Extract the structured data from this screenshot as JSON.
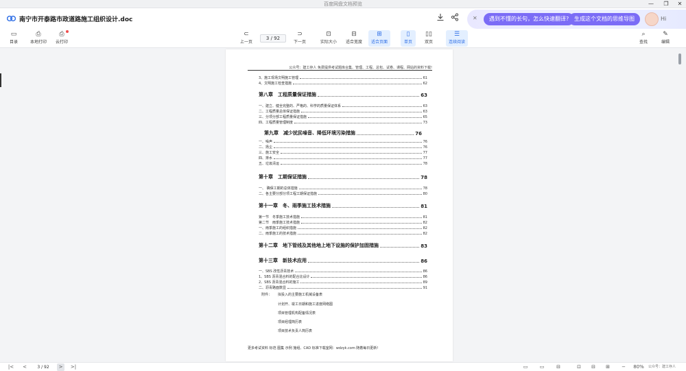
{
  "window": {
    "app_title": "百度网盘文档预览",
    "minimize": "—",
    "maximize": "❐",
    "close": "✕"
  },
  "header": {
    "doc_title": "南宁市开泰路市政道路施工组织设计.doc",
    "download_icon": "download-icon",
    "share_icon": "share-icon"
  },
  "ai_bar": {
    "close": "✕",
    "pill_translate": "遇到不懂的长句，怎么快速翻译?",
    "pill_mindmap": "生成这个文档的思维导图",
    "greeting": "Hi"
  },
  "toolbar": {
    "left": [
      {
        "label": "目录",
        "icon": "toc-icon",
        "glyph": "▭"
      },
      {
        "label": "本地打印",
        "icon": "print-icon",
        "glyph": "⎙"
      },
      {
        "label": "云打印",
        "icon": "cloud-print-icon",
        "glyph": "⎙"
      }
    ],
    "prev_label": "上一页",
    "next_label": "下一页",
    "page_value": "3 / 92",
    "views": [
      {
        "label": "实际大小",
        "glyph": "⊡"
      },
      {
        "label": "适合宽度",
        "glyph": "⊟"
      },
      {
        "label": "适合页面",
        "glyph": "⊞"
      },
      {
        "label": "单页",
        "glyph": "▯"
      },
      {
        "label": "双页",
        "glyph": "▯▯"
      },
      {
        "label": "连续阅读",
        "glyph": "☰"
      }
    ],
    "find_label": "查找",
    "edit_label": "编辑"
  },
  "document": {
    "running_header": "公众号：建工存人 免费提供考试题库合集、管理、工程、总包、试卷、课程、网站的资料下载!",
    "toc": [
      {
        "type": "it",
        "text": "3、施工现场文明施工管理",
        "page": "61"
      },
      {
        "type": "it",
        "text": "4、文明施工检查措施",
        "page": "62"
      },
      {
        "type": "ch",
        "text": "第八章　工程质量保证措施",
        "page": "63"
      },
      {
        "type": "it",
        "text": "一、建立、健全完整的、严格的、科学的质量保证体系",
        "page": "63"
      },
      {
        "type": "it",
        "text": "二、工程质量总体保证措施",
        "page": "63"
      },
      {
        "type": "it",
        "text": "三、分项分部工程质量保证措施",
        "page": "65"
      },
      {
        "type": "it",
        "text": "四、工程质量管理制度",
        "page": "73"
      },
      {
        "type": "ch",
        "text": "第九章　减少扰民噪音、降低环境污染措施",
        "page": "76"
      },
      {
        "type": "it",
        "text": "一、噪声",
        "page": "76"
      },
      {
        "type": "it",
        "text": "二、扬尘",
        "page": "76"
      },
      {
        "type": "it",
        "text": "三、施工安全",
        "page": "77"
      },
      {
        "type": "it",
        "text": "四、排水",
        "page": "77"
      },
      {
        "type": "it",
        "text": "五、垃圾清运",
        "page": "78"
      },
      {
        "type": "ch",
        "text": "第十章　工期保证措施",
        "page": "78"
      },
      {
        "type": "it",
        "text": "一、 确保工期的总体措施",
        "page": "78"
      },
      {
        "type": "it",
        "text": "二、各主要分部分项工程工期保证措施",
        "page": "80"
      },
      {
        "type": "ch",
        "text": "第十一章　冬、雨季施工技术措施",
        "page": "81"
      },
      {
        "type": "it",
        "text": "第一节　冬季施工技术措施",
        "page": "81"
      },
      {
        "type": "it",
        "text": "第二节　雨季施工技术措施",
        "page": "82"
      },
      {
        "type": "it",
        "text": "一、雨季施工的组织措施",
        "page": "82"
      },
      {
        "type": "it",
        "text": "二、雨季施工的技术措施",
        "page": "82"
      },
      {
        "type": "ch",
        "text": "第十二章　地下管线及其他地上地下设施的保护加固措施",
        "page": "83"
      },
      {
        "type": "ch",
        "text": "第十三章　新技术应用",
        "page": "86"
      },
      {
        "type": "it",
        "text": "一、SBS 改性沥青技术",
        "page": "86"
      },
      {
        "type": "it",
        "text": "1、SBS 沥青混合料的配合比设计",
        "page": "86"
      },
      {
        "type": "it",
        "text": "2、SBS 沥青混合料的施工",
        "page": "89"
      },
      {
        "type": "it",
        "text": "二、沥青路面数显",
        "page": "91"
      }
    ],
    "attachments_label": "附件：",
    "attachments": [
      "拟投入的主要施工机械设备表",
      "计划开、竣工日期和施工进度网络图",
      "项目管理机构配备情况表",
      "项目经理简历表",
      "项目技术负责人简历表"
    ],
    "footer": "更多考试资料 标范 图集 示例 施组、CAD 标准下载室网：wdzyk.com 随着每日更新!"
  },
  "statusbar": {
    "first": "|<",
    "prev": "<",
    "page": "3 / 92",
    "next": ">",
    "last": ">|",
    "zoom": "80%",
    "watermark": "公众号：建工存人"
  }
}
